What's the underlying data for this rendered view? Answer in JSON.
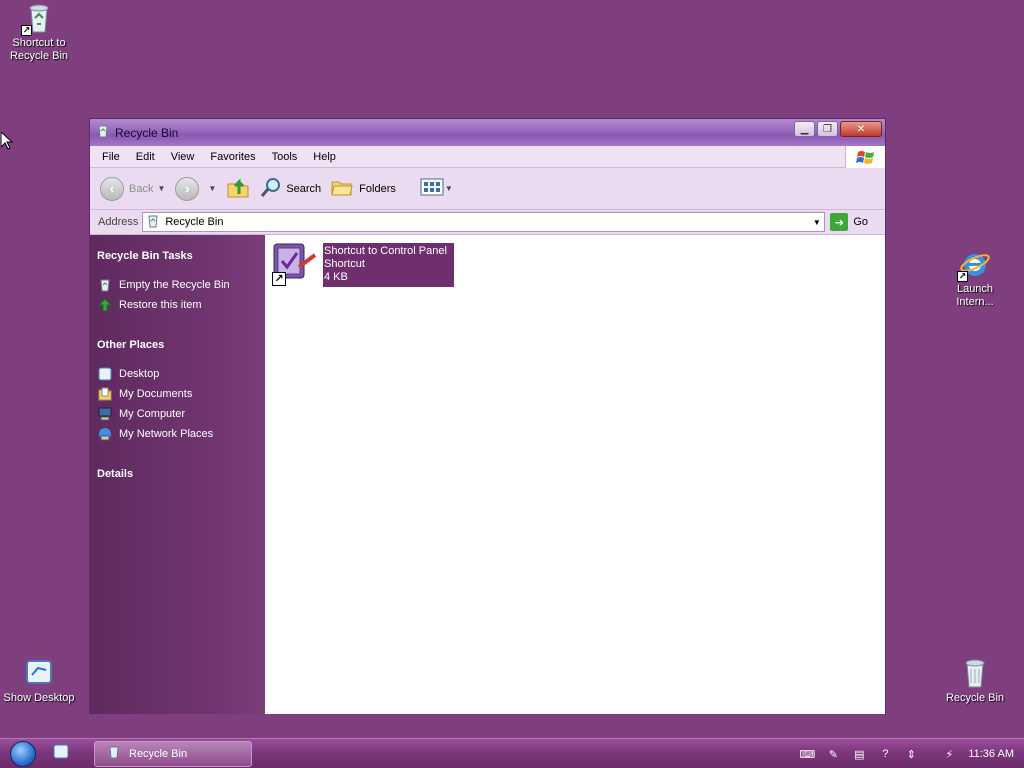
{
  "desktop": {
    "icons": [
      {
        "label": "Shortcut to Recycle Bin"
      },
      {
        "label": "Launch Intern..."
      },
      {
        "label": "Show Desktop"
      },
      {
        "label": "Recycle Bin"
      }
    ]
  },
  "window": {
    "title": "Recycle Bin",
    "menu": [
      "File",
      "Edit",
      "View",
      "Favorites",
      "Tools",
      "Help"
    ],
    "toolbar": {
      "back": "Back",
      "search": "Search",
      "folders": "Folders"
    },
    "address": {
      "label": "Address",
      "value": "Recycle Bin",
      "go": "Go"
    },
    "sidepane": {
      "tasks_header": "Recycle Bin Tasks",
      "tasks": [
        "Empty the Recycle Bin",
        "Restore this item"
      ],
      "places_header": "Other Places",
      "places": [
        "Desktop",
        "My Documents",
        "My Computer",
        "My Network Places"
      ],
      "details_header": "Details"
    },
    "files": [
      {
        "name": "Shortcut to Control Panel",
        "type": "Shortcut",
        "size": "4 KB"
      }
    ]
  },
  "taskbar": {
    "task_label": "Recycle Bin",
    "clock": "11:36 AM"
  },
  "colors": {
    "desktop": "#7f3f7f",
    "sidepane": "#6a2f6a",
    "selection": "#6f2f6f"
  }
}
